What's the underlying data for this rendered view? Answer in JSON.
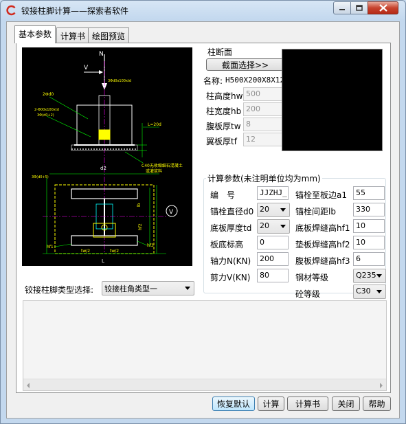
{
  "window": {
    "title": "铰接柱脚计算——探索者软件"
  },
  "tabs": [
    {
      "label": "基本参数"
    },
    {
      "label": "计算书"
    },
    {
      "label": "绘图预览"
    }
  ],
  "drawing": {
    "labels": {
      "n": "N",
      "v": "V",
      "v_circle": "V",
      "d2": "d2",
      "l": "L",
      "b": "B",
      "c40": "C40无收缩细石混凝土",
      "c40b": "或灌浆料",
      "hf1": "hf1",
      "hf2": "hf2",
      "hf3": "hf3",
      "lb": "lb",
      "tw_half": "tw/2",
      "anchor": "2-Φ00x100xtd",
      "plate": "3Φ(d0+5)",
      "ld": "L=20d",
      "cap": "2Φd0"
    }
  },
  "section": {
    "group_title": "柱断面",
    "select_button": "截面选择>>",
    "name_label": "名称:",
    "name_value": "H500X200X8X12",
    "fields": [
      {
        "label": "柱高度hw",
        "value": "500"
      },
      {
        "label": "柱宽度hb",
        "value": "200"
      },
      {
        "label": "腹板厚tw",
        "value": "8"
      },
      {
        "label": "翼板厚tf",
        "value": "12"
      }
    ]
  },
  "params": {
    "group_title": "计算参数(未注明单位均为mm)",
    "left": [
      {
        "label": "编　号",
        "value": "JJZHJ_1",
        "kind": "input"
      },
      {
        "label": "锚栓直径d0",
        "value": "20",
        "kind": "select"
      },
      {
        "label": "底板厚度td",
        "value": "20",
        "kind": "select"
      },
      {
        "label": "板底标高",
        "value": "0",
        "kind": "input"
      },
      {
        "label": "轴力N(KN)",
        "value": "200",
        "kind": "input"
      },
      {
        "label": "剪力V(KN)",
        "value": "80",
        "kind": "input"
      }
    ],
    "right": [
      {
        "label": "锚栓至板边a1",
        "value": "55",
        "kind": "input"
      },
      {
        "label": "锚栓间距lb",
        "value": "330",
        "kind": "input"
      },
      {
        "label": "底板焊缝高hf1",
        "value": "10",
        "kind": "input"
      },
      {
        "label": "垫板焊缝高hf2",
        "value": "10",
        "kind": "input"
      },
      {
        "label": "腹板焊缝高hf3",
        "value": "6",
        "kind": "input"
      },
      {
        "label": "钢材等级",
        "value": "Q235",
        "kind": "select"
      },
      {
        "label": "砼等级",
        "value": "C30",
        "kind": "select"
      }
    ]
  },
  "type_select": {
    "label": "铰接柱脚类型选择:",
    "value": "铰接柱角类型一"
  },
  "buttons": {
    "restore": "恢复默认",
    "calc": "计算",
    "report": "计算书",
    "close": "关闭",
    "help": "帮助"
  },
  "colors": {
    "cad_background": "#000000",
    "cad_green": "#00ff00",
    "cad_yellow": "#ffff00",
    "cad_white": "#ffffff",
    "cad_cyan": "#00ffff",
    "cad_magenta": "#ff00ff"
  }
}
